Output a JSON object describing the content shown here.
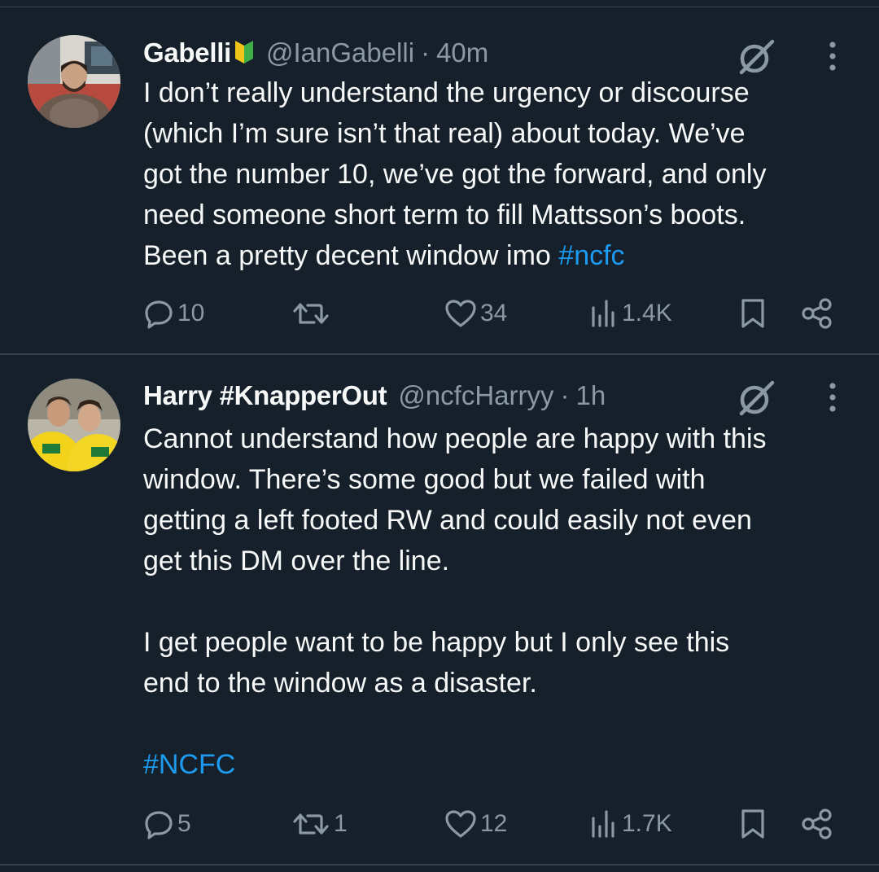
{
  "tweets": [
    {
      "name": "Gabelli",
      "badge": "beginner-badge-icon",
      "handle": "@IanGabelli",
      "separator": "·",
      "time": "40m",
      "lines": [
        "I don’t really understand the urgency or discourse",
        "(which I’m sure isn’t that real) about today. We’ve",
        "got the number 10, we’ve got the forward, and only",
        "need someone short term to fill Mattsson’s boots.",
        "Been a pretty decent window imo "
      ],
      "hashtag": "#ncfc",
      "replies": "10",
      "reposts": "",
      "likes": "34",
      "views": "1.4K"
    },
    {
      "name": "Harry #KnapperOut",
      "handle": "@ncfcHarryy",
      "separator": "·",
      "time": "1h",
      "lines": [
        "Cannot understand how people are happy with this",
        "window. There’s some good but we failed with",
        "getting a left footed RW and could easily not even",
        "get this DM over the line.",
        "I get people want to be happy but I only see this",
        "end to the window as a disaster."
      ],
      "hashtag": "#NCFC",
      "replies": "5",
      "reposts": "1",
      "likes": "12",
      "views": "1.7K"
    }
  ],
  "colors": {
    "background": "#15202b",
    "text": "#f7f9f9",
    "muted": "#8b98a5",
    "link": "#1d9bf0",
    "divider": "#38444d"
  },
  "icons": [
    "reply-icon",
    "repost-icon",
    "like-icon",
    "views-icon",
    "bookmark-icon",
    "share-icon",
    "grok-icon",
    "more-icon"
  ]
}
